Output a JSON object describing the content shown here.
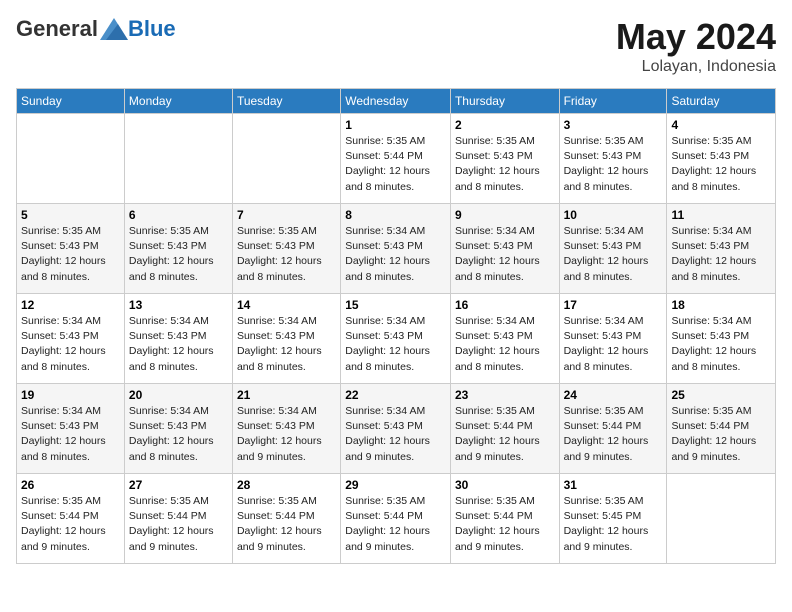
{
  "header": {
    "logo": {
      "general": "General",
      "blue": "Blue"
    },
    "month_title": "May 2024",
    "location": "Lolayan, Indonesia"
  },
  "weekdays": [
    "Sunday",
    "Monday",
    "Tuesday",
    "Wednesday",
    "Thursday",
    "Friday",
    "Saturday"
  ],
  "weeks": [
    [
      {
        "day": "",
        "info": ""
      },
      {
        "day": "",
        "info": ""
      },
      {
        "day": "",
        "info": ""
      },
      {
        "day": "1",
        "info": "Sunrise: 5:35 AM\nSunset: 5:44 PM\nDaylight: 12 hours\nand 8 minutes."
      },
      {
        "day": "2",
        "info": "Sunrise: 5:35 AM\nSunset: 5:43 PM\nDaylight: 12 hours\nand 8 minutes."
      },
      {
        "day": "3",
        "info": "Sunrise: 5:35 AM\nSunset: 5:43 PM\nDaylight: 12 hours\nand 8 minutes."
      },
      {
        "day": "4",
        "info": "Sunrise: 5:35 AM\nSunset: 5:43 PM\nDaylight: 12 hours\nand 8 minutes."
      }
    ],
    [
      {
        "day": "5",
        "info": "Sunrise: 5:35 AM\nSunset: 5:43 PM\nDaylight: 12 hours\nand 8 minutes."
      },
      {
        "day": "6",
        "info": "Sunrise: 5:35 AM\nSunset: 5:43 PM\nDaylight: 12 hours\nand 8 minutes."
      },
      {
        "day": "7",
        "info": "Sunrise: 5:35 AM\nSunset: 5:43 PM\nDaylight: 12 hours\nand 8 minutes."
      },
      {
        "day": "8",
        "info": "Sunrise: 5:34 AM\nSunset: 5:43 PM\nDaylight: 12 hours\nand 8 minutes."
      },
      {
        "day": "9",
        "info": "Sunrise: 5:34 AM\nSunset: 5:43 PM\nDaylight: 12 hours\nand 8 minutes."
      },
      {
        "day": "10",
        "info": "Sunrise: 5:34 AM\nSunset: 5:43 PM\nDaylight: 12 hours\nand 8 minutes."
      },
      {
        "day": "11",
        "info": "Sunrise: 5:34 AM\nSunset: 5:43 PM\nDaylight: 12 hours\nand 8 minutes."
      }
    ],
    [
      {
        "day": "12",
        "info": "Sunrise: 5:34 AM\nSunset: 5:43 PM\nDaylight: 12 hours\nand 8 minutes."
      },
      {
        "day": "13",
        "info": "Sunrise: 5:34 AM\nSunset: 5:43 PM\nDaylight: 12 hours\nand 8 minutes."
      },
      {
        "day": "14",
        "info": "Sunrise: 5:34 AM\nSunset: 5:43 PM\nDaylight: 12 hours\nand 8 minutes."
      },
      {
        "day": "15",
        "info": "Sunrise: 5:34 AM\nSunset: 5:43 PM\nDaylight: 12 hours\nand 8 minutes."
      },
      {
        "day": "16",
        "info": "Sunrise: 5:34 AM\nSunset: 5:43 PM\nDaylight: 12 hours\nand 8 minutes."
      },
      {
        "day": "17",
        "info": "Sunrise: 5:34 AM\nSunset: 5:43 PM\nDaylight: 12 hours\nand 8 minutes."
      },
      {
        "day": "18",
        "info": "Sunrise: 5:34 AM\nSunset: 5:43 PM\nDaylight: 12 hours\nand 8 minutes."
      }
    ],
    [
      {
        "day": "19",
        "info": "Sunrise: 5:34 AM\nSunset: 5:43 PM\nDaylight: 12 hours\nand 8 minutes."
      },
      {
        "day": "20",
        "info": "Sunrise: 5:34 AM\nSunset: 5:43 PM\nDaylight: 12 hours\nand 8 minutes."
      },
      {
        "day": "21",
        "info": "Sunrise: 5:34 AM\nSunset: 5:43 PM\nDaylight: 12 hours\nand 9 minutes."
      },
      {
        "day": "22",
        "info": "Sunrise: 5:34 AM\nSunset: 5:43 PM\nDaylight: 12 hours\nand 9 minutes."
      },
      {
        "day": "23",
        "info": "Sunrise: 5:35 AM\nSunset: 5:44 PM\nDaylight: 12 hours\nand 9 minutes."
      },
      {
        "day": "24",
        "info": "Sunrise: 5:35 AM\nSunset: 5:44 PM\nDaylight: 12 hours\nand 9 minutes."
      },
      {
        "day": "25",
        "info": "Sunrise: 5:35 AM\nSunset: 5:44 PM\nDaylight: 12 hours\nand 9 minutes."
      }
    ],
    [
      {
        "day": "26",
        "info": "Sunrise: 5:35 AM\nSunset: 5:44 PM\nDaylight: 12 hours\nand 9 minutes."
      },
      {
        "day": "27",
        "info": "Sunrise: 5:35 AM\nSunset: 5:44 PM\nDaylight: 12 hours\nand 9 minutes."
      },
      {
        "day": "28",
        "info": "Sunrise: 5:35 AM\nSunset: 5:44 PM\nDaylight: 12 hours\nand 9 minutes."
      },
      {
        "day": "29",
        "info": "Sunrise: 5:35 AM\nSunset: 5:44 PM\nDaylight: 12 hours\nand 9 minutes."
      },
      {
        "day": "30",
        "info": "Sunrise: 5:35 AM\nSunset: 5:44 PM\nDaylight: 12 hours\nand 9 minutes."
      },
      {
        "day": "31",
        "info": "Sunrise: 5:35 AM\nSunset: 5:45 PM\nDaylight: 12 hours\nand 9 minutes."
      },
      {
        "day": "",
        "info": ""
      }
    ]
  ]
}
